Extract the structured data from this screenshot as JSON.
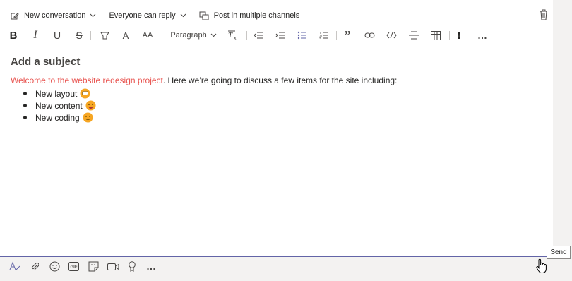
{
  "topbar": {
    "new_conversation": "New conversation",
    "reply_setting": "Everyone can reply",
    "post_multiple": "Post in multiple channels"
  },
  "toolbar": {
    "paragraph": "Paragraph",
    "bold": "B",
    "italic": "I",
    "underline": "U",
    "strike": "S",
    "font_color": "A",
    "font_size": "AA",
    "quote": "”",
    "important": "!",
    "more": "…"
  },
  "editor": {
    "subject_placeholder": "Add a subject",
    "intro_highlight": "Welcome to the website redesign project",
    "intro_rest": ". Here we’re going to discuss a few items for the site including:",
    "items": [
      {
        "label": "New layout",
        "emoji": "grinning-face"
      },
      {
        "label": "New content",
        "emoji": "smiling-face"
      },
      {
        "label": "New coding",
        "emoji": "slightly-smiling-face"
      }
    ]
  },
  "tooltip": {
    "send": "Send"
  },
  "colors": {
    "accent": "#6264a7",
    "highlight": "#e8534f",
    "emoji": "#f6a623"
  }
}
